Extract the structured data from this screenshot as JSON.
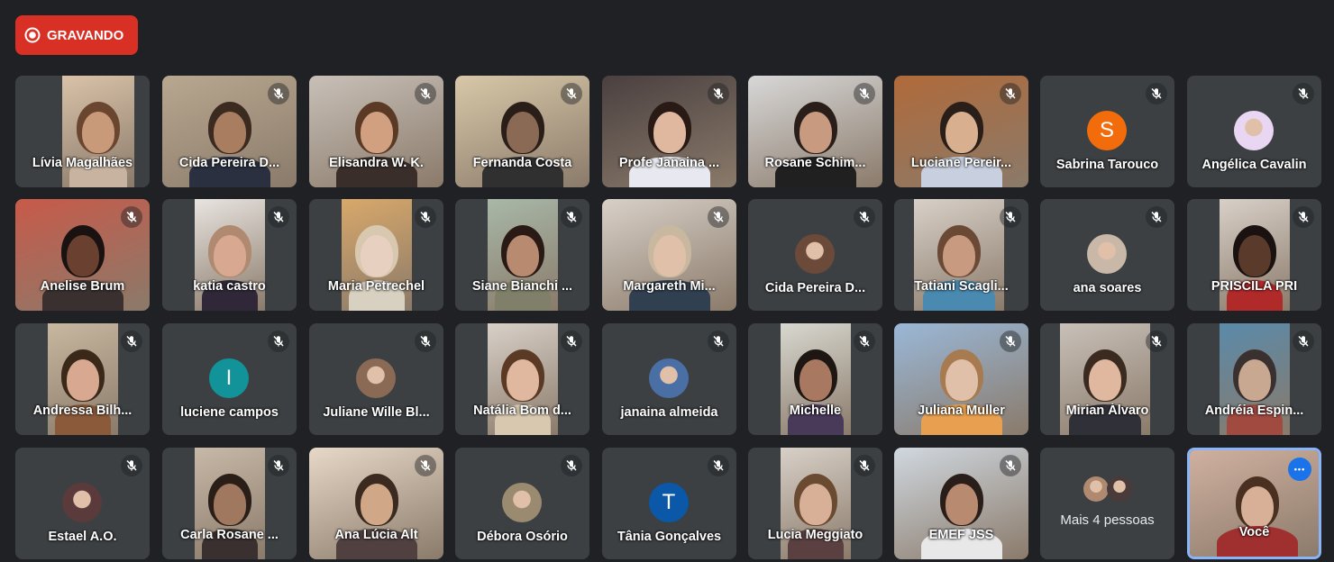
{
  "recording": {
    "label": "GRAVANDO",
    "color": "#d93025"
  },
  "participants": [
    {
      "name": "Lívia Magalhães",
      "video": true,
      "muted": false
    },
    {
      "name": "Cida Pereira D...",
      "video": true,
      "muted": true
    },
    {
      "name": "Elisandra W. K.",
      "video": true,
      "muted": true
    },
    {
      "name": "Fernanda Costa",
      "video": true,
      "muted": true
    },
    {
      "name": "Profe Janaina ...",
      "video": true,
      "muted": true
    },
    {
      "name": "Rosane Schim...",
      "video": true,
      "muted": true
    },
    {
      "name": "Luciane Pereir...",
      "video": true,
      "muted": true
    },
    {
      "name": "Sabrina Tarouco",
      "video": false,
      "muted": true,
      "avatar_letter": "S",
      "avatar_color": "#f26c0c"
    },
    {
      "name": "Angélica Cavalin",
      "video": false,
      "muted": true,
      "avatar_letter": "",
      "avatar_color": "#e9d6f2"
    },
    {
      "name": "Anelise Brum",
      "video": true,
      "muted": true
    },
    {
      "name": "katia castro",
      "video": true,
      "muted": true
    },
    {
      "name": "Maria Petrechel",
      "video": true,
      "muted": true
    },
    {
      "name": "Siane Bianchi ...",
      "video": true,
      "muted": true
    },
    {
      "name": "Margareth Mi...",
      "video": true,
      "muted": true
    },
    {
      "name": "Cida Pereira D...",
      "video": false,
      "muted": true,
      "avatar_letter": "",
      "avatar_color": "#6b4a3a"
    },
    {
      "name": "Tatiani Scagli...",
      "video": true,
      "muted": true
    },
    {
      "name": "ana soares",
      "video": false,
      "muted": true,
      "avatar_letter": "",
      "avatar_color": "#c9b8a8"
    },
    {
      "name": "PRISCILA PRI",
      "video": true,
      "muted": true
    },
    {
      "name": "Andressa Bilh...",
      "video": true,
      "muted": true
    },
    {
      "name": "luciene campos",
      "video": false,
      "muted": true,
      "avatar_letter": "I",
      "avatar_color": "#12939a"
    },
    {
      "name": "Juliane Wille Bl...",
      "video": false,
      "muted": true,
      "avatar_letter": "",
      "avatar_color": "#8a6a55"
    },
    {
      "name": "Natália Bom d...",
      "video": true,
      "muted": true
    },
    {
      "name": "janaina almeida",
      "video": false,
      "muted": true,
      "avatar_letter": "",
      "avatar_color": "#4a6fa5"
    },
    {
      "name": "Michelle",
      "video": true,
      "muted": true
    },
    {
      "name": "Juliana Muller",
      "video": true,
      "muted": true
    },
    {
      "name": "Mirian Álvaro",
      "video": true,
      "muted": true
    },
    {
      "name": "Andréia Espin...",
      "video": true,
      "muted": true
    },
    {
      "name": "Estael A.O.",
      "video": false,
      "muted": true,
      "avatar_letter": "",
      "avatar_color": "#5a3a3a"
    },
    {
      "name": "Carla Rosane ...",
      "video": true,
      "muted": true
    },
    {
      "name": "Ana Lúcia Alt",
      "video": true,
      "muted": true
    },
    {
      "name": "Débora Osório",
      "video": false,
      "muted": true,
      "avatar_letter": "",
      "avatar_color": "#9a8a70"
    },
    {
      "name": "Tânia Gonçalves",
      "video": false,
      "muted": true,
      "avatar_letter": "T",
      "avatar_color": "#0b57a8"
    },
    {
      "name": "Lucia Meggiato",
      "video": true,
      "muted": true
    },
    {
      "name": "EMEF JSS",
      "video": true,
      "muted": true
    },
    {
      "name": "Mais 4 pessoas",
      "video": false,
      "muted": false,
      "overflow": true
    },
    {
      "name": "Você",
      "video": true,
      "muted": false,
      "self": true
    }
  ]
}
